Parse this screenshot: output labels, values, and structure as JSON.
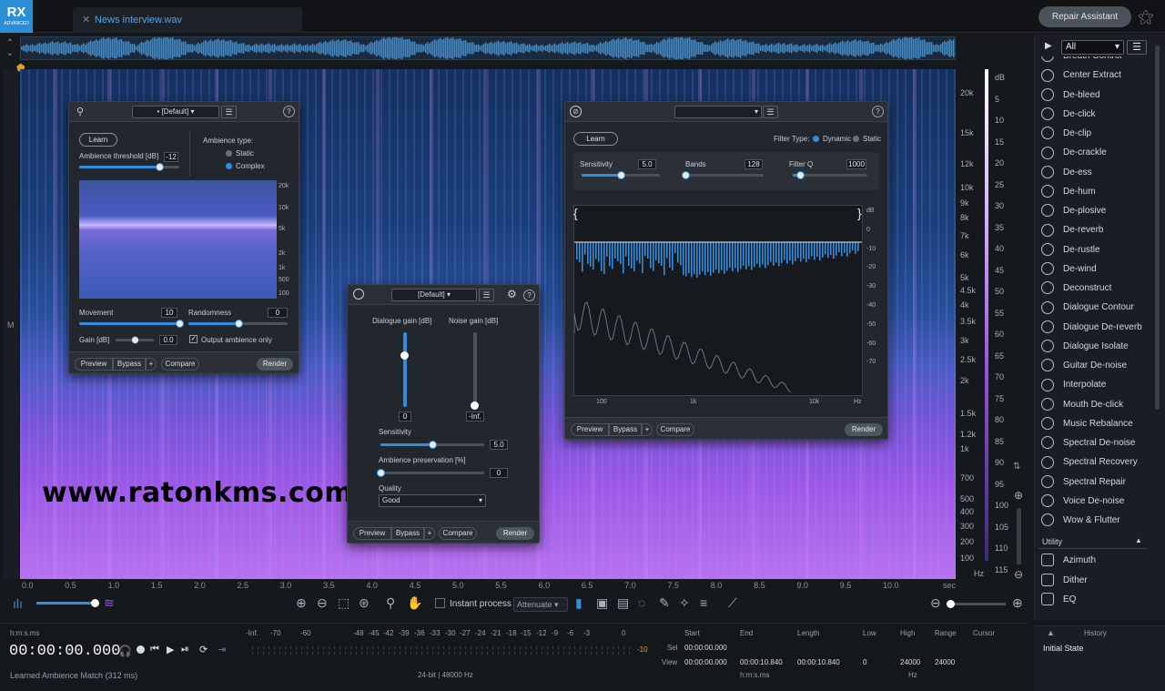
{
  "app": {
    "logo": "RX",
    "logo_sub": "ADVANCED",
    "file_tab": "News interview.wav",
    "repair_assistant": "Repair Assistant"
  },
  "watermark": "www.ratonkms.com",
  "hz_axis": [
    "20k",
    "15k",
    "12k",
    "10k",
    "9k",
    "8k",
    "7k",
    "6k",
    "5k",
    "4.5k",
    "4k",
    "3.5k",
    "3k",
    "2.5k",
    "2k",
    "1.5k",
    "1.2k",
    "1k",
    "700",
    "500",
    "400",
    "300",
    "200",
    "100",
    "Hz"
  ],
  "db_axis": [
    "dB",
    "5",
    "10",
    "15",
    "20",
    "25",
    "30",
    "35",
    "40",
    "45",
    "50",
    "55",
    "60",
    "65",
    "70",
    "75",
    "80",
    "85",
    "90",
    "95",
    "100",
    "105",
    "110",
    "115"
  ],
  "time_axis": [
    "0.0",
    "0.5",
    "1.0",
    "1.5",
    "2.0",
    "2.5",
    "3.0",
    "3.5",
    "4.0",
    "4.5",
    "5.0",
    "5.5",
    "6.0",
    "6.5",
    "7.0",
    "7.5",
    "8.0",
    "8.5",
    "9.0",
    "9.5",
    "10.0",
    "sec"
  ],
  "left_gutter_label": "M",
  "modules": [
    "Breath Control",
    "Center Extract",
    "De-bleed",
    "De-click",
    "De-clip",
    "De-crackle",
    "De-ess",
    "De-hum",
    "De-plosive",
    "De-reverb",
    "De-rustle",
    "De-wind",
    "Deconstruct",
    "Dialogue Contour",
    "Dialogue De-reverb",
    "Dialogue Isolate",
    "Guitar De-noise",
    "Interpolate",
    "Mouth De-click",
    "Music Rebalance",
    "Spectral De-noise",
    "Spectral Recovery",
    "Spectral Repair",
    "Voice De-noise",
    "Wow & Flutter"
  ],
  "module_filter": "All",
  "utility": {
    "header": "Utility",
    "items": [
      "Azimuth",
      "Dither",
      "EQ"
    ]
  },
  "history": {
    "header": "History",
    "items": [
      "Initial State"
    ]
  },
  "toolbar": {
    "instant_process": "Instant process",
    "attenuate": "Attenuate"
  },
  "transport": {
    "time_format": "h:m:s.ms",
    "time": "00:00:00.000",
    "status": "Learned Ambience Match (312 ms)"
  },
  "meter": {
    "scale": [
      "-Inf.",
      "-70",
      "-60",
      "-48",
      "-45",
      "-42",
      "-39",
      "-36",
      "-33",
      "-30",
      "-27",
      "-24",
      "-21",
      "-18",
      "-15",
      "-12",
      "-9",
      "-6",
      "-3",
      "0"
    ],
    "peak": "-10",
    "format": "24-bit | 48000 Hz"
  },
  "selection": {
    "start_h": "Start",
    "end_h": "End",
    "length_h": "Length",
    "sel_label": "Sel",
    "view_label": "View",
    "sel_start": "00:00:00.000",
    "view_start": "00:00:00.000",
    "view_end": "00:00:10.840",
    "view_length": "00:00:10.840",
    "unit": "h:m:s.ms"
  },
  "freq": {
    "low_h": "Low",
    "high_h": "High",
    "range_h": "Range",
    "low": "0",
    "high": "24000",
    "range": "24000",
    "unit": "Hz",
    "cursor_h": "Cursor"
  },
  "win1": {
    "preset": "• [Default]",
    "learn": "Learn",
    "threshold_label": "Ambience threshold [dB]",
    "threshold": "-12",
    "ambience_type": "Ambience type:",
    "static": "Static",
    "complex": "Complex",
    "freq_labels": [
      "20k",
      "10k",
      "5k",
      "2k",
      "1k",
      "500",
      "100"
    ],
    "movement_label": "Movement",
    "movement": "10",
    "randomness_label": "Randomness",
    "randomness": "0",
    "gain_label": "Gain [dB]",
    "gain": "0.0",
    "output_label": "Output ambience only",
    "preview": "Preview",
    "bypass": "Bypass",
    "plus": "+",
    "compare": "Compare",
    "render": "Render",
    "threshold_frac": 0.8,
    "movement_frac": 1.0,
    "randomness_frac": 0.5,
    "gain_frac": 0.5
  },
  "win2": {
    "preset": "[Default]",
    "dialogue_gain_label": "Dialogue gain [dB]",
    "noise_gain_label": "Noise gain [dB]",
    "dialogue_gain": "0",
    "noise_gain": "-Inf.",
    "sensitivity_label": "Sensitivity",
    "sensitivity": "5.0",
    "ambience_label": "Ambience preservation [%]",
    "ambience": "0",
    "quality_label": "Quality",
    "quality": "Good",
    "preview": "Preview",
    "bypass": "Bypass",
    "plus": "+",
    "compare": "Compare",
    "render": "Render",
    "sensitivity_frac": 0.5,
    "ambience_frac": 0.0
  },
  "win3": {
    "learn": "Learn",
    "filter_type": "Filter Type:",
    "dynamic": "Dynamic",
    "static": "Static",
    "sensitivity_label": "Sensitivity",
    "sensitivity": "5.0",
    "bands_label": "Bands",
    "bands": "128",
    "filterq_label": "Filter Q",
    "filterq": "1000",
    "db_labels": [
      "dB",
      "0",
      "-10",
      "-20",
      "-30",
      "-40",
      "-50",
      "-60",
      "-70"
    ],
    "hz_labels": [
      "100",
      "1k",
      "10k",
      "Hz"
    ],
    "preview": "Preview",
    "bypass": "Bypass",
    "plus": "+",
    "compare": "Compare",
    "render": "Render",
    "sensitivity_frac": 0.5,
    "bands_frac": 0.0,
    "filterq_frac": 0.1
  },
  "colors": {
    "accent": "#2f8ee0",
    "playhead": "#e0a028"
  }
}
